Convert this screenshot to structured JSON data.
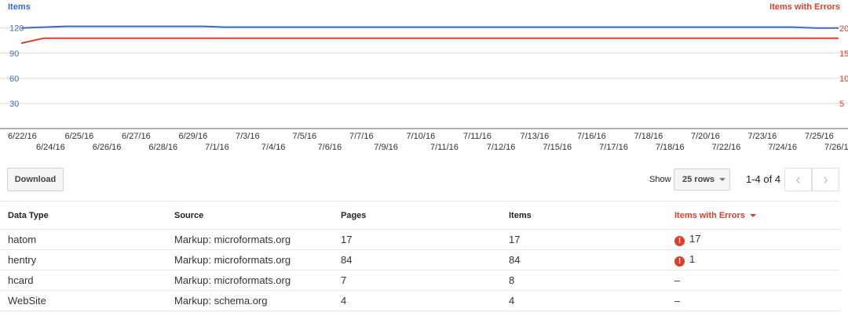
{
  "chart_data": {
    "type": "line",
    "legend_left": "Items",
    "legend_right": "Items with Errors",
    "y_left": {
      "ticks": [
        "120",
        "90",
        "60",
        "30"
      ],
      "values": [
        120,
        90,
        60,
        30
      ],
      "range": [
        0,
        130
      ]
    },
    "y_right": {
      "ticks": [
        "20",
        "15",
        "10",
        "5"
      ],
      "values": [
        20,
        15,
        10,
        5
      ],
      "range": [
        0,
        21.7
      ]
    },
    "x_ticks_upper": [
      "6/22/16",
      "6/25/16",
      "6/27/16",
      "6/29/16",
      "7/3/16",
      "7/5/16",
      "7/7/16",
      "7/10/16",
      "7/11/16",
      "7/13/16",
      "7/16/16",
      "7/18/16",
      "7/20/16",
      "7/23/16",
      "7/25/16"
    ],
    "x_ticks_lower": [
      "6/24/16",
      "6/26/16",
      "6/28/16",
      "7/1/16",
      "7/4/16",
      "7/6/16",
      "7/9/16",
      "7/11/16",
      "7/12/16",
      "7/15/16",
      "7/17/16",
      "7/18/16",
      "7/22/16",
      "7/24/16",
      "7/26/1"
    ],
    "series": [
      {
        "name": "Items",
        "color": "#3a6bc5",
        "axis": "left",
        "values": [
          120,
          121,
          122,
          122,
          122,
          122,
          122,
          122,
          122,
          121,
          121,
          121,
          121,
          121,
          121,
          121,
          121,
          121,
          121,
          121,
          121,
          121,
          121,
          121,
          121,
          121,
          121,
          121,
          121,
          121,
          121,
          121,
          121,
          121,
          121,
          120,
          120
        ]
      },
      {
        "name": "Items with Errors",
        "color": "#d8402c",
        "axis": "right",
        "values": [
          17,
          18,
          18,
          18,
          18,
          18,
          18,
          18,
          18,
          18,
          18,
          18,
          18,
          18,
          18,
          18,
          18,
          18,
          18,
          18,
          18,
          18,
          18,
          18,
          18,
          18,
          18,
          18,
          18,
          18,
          18,
          18,
          18,
          18,
          18,
          18,
          18
        ]
      }
    ]
  },
  "toolbar": {
    "download_label": "Download",
    "show_label": "Show",
    "rows_value": "25 rows",
    "range_label": "1-4 of 4",
    "prev_icon": "‹",
    "next_icon": "›"
  },
  "table": {
    "headers": [
      "Data Type",
      "Source",
      "Pages",
      "Items",
      "Items with Errors"
    ],
    "rows": [
      {
        "type": "hatom",
        "source": "Markup: microformats.org",
        "pages": "17",
        "items": "17",
        "errors": "17",
        "has_error": true
      },
      {
        "type": "hentry",
        "source": "Markup: microformats.org",
        "pages": "84",
        "items": "84",
        "errors": "1",
        "has_error": true
      },
      {
        "type": "hcard",
        "source": "Markup: microformats.org",
        "pages": "7",
        "items": "8",
        "errors": "–",
        "has_error": false
      },
      {
        "type": "WebSite",
        "source": "Markup: schema.org",
        "pages": "4",
        "items": "4",
        "errors": "–",
        "has_error": false
      }
    ]
  }
}
